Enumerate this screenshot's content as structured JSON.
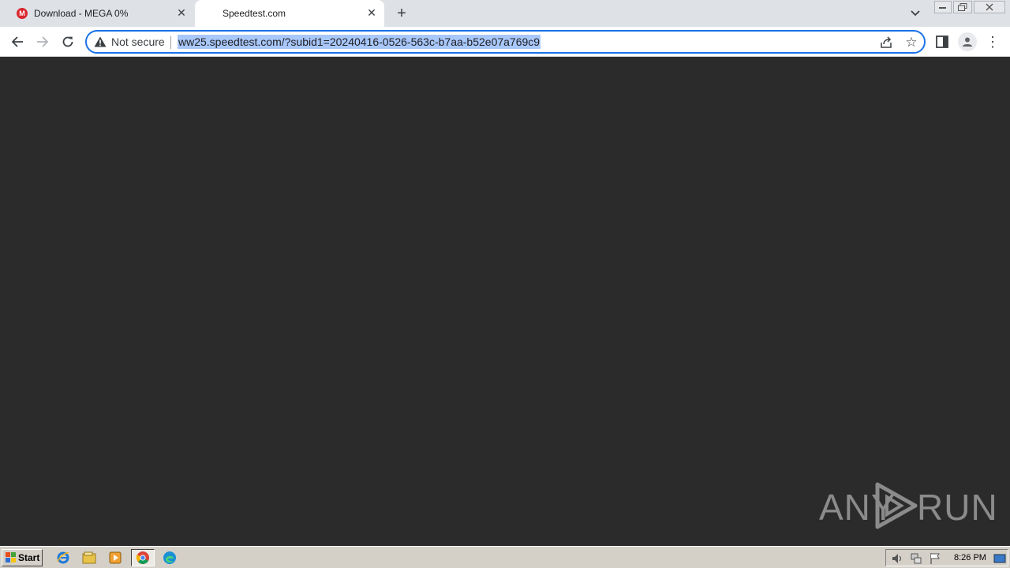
{
  "tabs": [
    {
      "title": "Download - MEGA 0%",
      "favicon": "mega-logo-icon",
      "active": false
    },
    {
      "title": "Speedtest.com",
      "favicon": "blank-page-icon",
      "active": true
    }
  ],
  "omnibox": {
    "security_label": "Not secure",
    "url": "ww25.speedtest.com/?subid1=20240416-0526-563c-b7aa-b52e07a769c9"
  },
  "watermark": {
    "left": "ANY",
    "right": "RUN"
  },
  "taskbar": {
    "start_label": "Start",
    "clock": "8:26 PM",
    "apps": [
      "internet-explorer-icon",
      "file-explorer-icon",
      "media-player-icon",
      "chrome-icon",
      "edge-icon"
    ]
  },
  "colors": {
    "page_bg": "#2b2b2b",
    "focus_ring": "#1a73e8",
    "url_highlight": "#a8c7fa",
    "mega_red": "#d9272e"
  }
}
